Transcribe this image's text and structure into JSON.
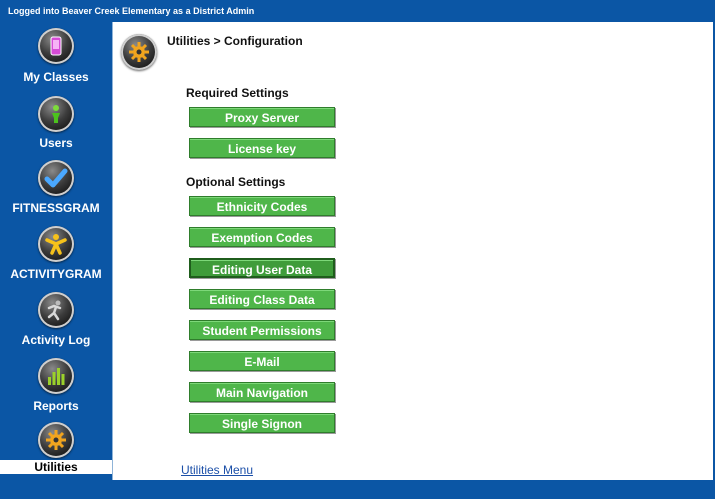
{
  "topbar": {
    "status_text": "Logged into Beaver Creek Elementary as a District Admin"
  },
  "sidebar": {
    "items": [
      {
        "label": "My Classes",
        "icon": "phone-icon"
      },
      {
        "label": "Users",
        "icon": "person-icon"
      },
      {
        "label": "FITNESSGRAM",
        "icon": "checkmark-icon"
      },
      {
        "label": "ACTIVITYGRAM",
        "icon": "jumping-figure-icon"
      },
      {
        "label": "Activity Log",
        "icon": "runner-icon"
      },
      {
        "label": "Reports",
        "icon": "bar-chart-icon"
      },
      {
        "label": "Utilities",
        "icon": "gear-icon",
        "active": true
      }
    ]
  },
  "main": {
    "breadcrumb": "Utilities > Configuration",
    "required_title": "Required Settings",
    "required_buttons": [
      "Proxy Server",
      "License key"
    ],
    "optional_title": "Optional Settings",
    "optional_buttons": [
      "Ethnicity Codes",
      "Exemption Codes",
      "Editing User Data",
      "Editing Class Data",
      "Student Permissions",
      "E-Mail",
      "Main Navigation",
      "Single Signon"
    ],
    "selected_button": "Editing User Data",
    "footer_link": "Utilities Menu"
  },
  "colors": {
    "frame": "#0b56a5",
    "button_green": "#4fb64a",
    "link": "#1b4fa8"
  }
}
